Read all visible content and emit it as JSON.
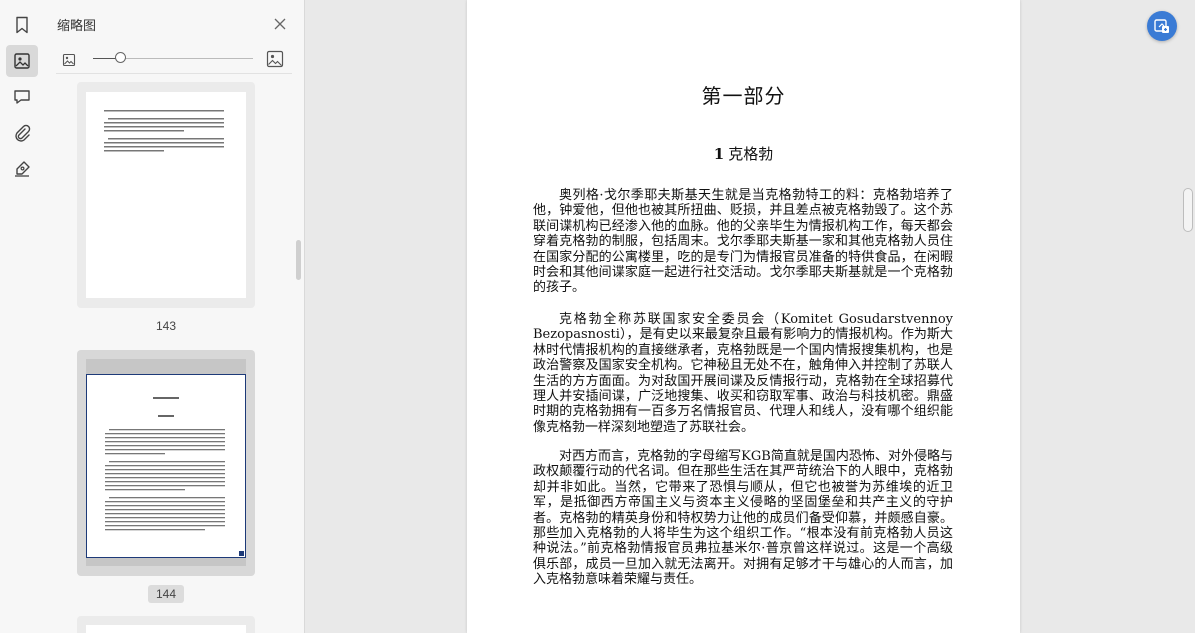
{
  "sidebar": {
    "icons": [
      {
        "name": "bookmark-icon",
        "active": false
      },
      {
        "name": "thumbnail-icon",
        "active": true
      },
      {
        "name": "comment-icon",
        "active": false
      },
      {
        "name": "attachment-icon",
        "active": false
      },
      {
        "name": "signature-icon",
        "active": false
      }
    ]
  },
  "thumbnail_panel": {
    "title": "缩略图",
    "zoom_level": 0.17,
    "thumbnails": [
      {
        "page_label": "143",
        "selected": false
      },
      {
        "page_label": "144",
        "selected": true
      }
    ]
  },
  "document": {
    "part_title": "第一部分",
    "chapter_number": "1",
    "chapter_title": "克格勃",
    "paragraphs": [
      "奥列格·戈尔季耶夫斯基天生就是当克格勃特工的料：克格勃培养了他，钟爱他，但他也被其所扭曲、贬损，并且差点被克格勃毁了。这个苏联间谍机构已经渗入他的血脉。他的父亲毕生为情报机构工作，每天都会穿着克格勃的制服，包括周末。戈尔季耶夫斯基一家和其他克格勃人员住在国家分配的公寓楼里，吃的是专门为情报官员准备的特供食品，在闲暇时会和其他间谍家庭一起进行社交活动。戈尔季耶夫斯基就是一个克格勃的孩子。",
      "克格勃全称苏联国家安全委员会（Komitet Gosudarstvennoy Bezopasnosti），是有史以来最复杂且最有影响力的情报机构。作为斯大林时代情报机构的直接继承者，克格勃既是一个国内情报搜集机构，也是政治警察及国家安全机构。它神秘且无处不在，触角伸入并控制了苏联人生活的方方面面。为对敌国开展间谍及反情报行动，克格勃在全球招募代理人并安插间谍，广泛地搜集、收买和窃取军事、政治与科技机密。鼎盛时期的克格勃拥有一百多万名情报官员、代理人和线人，没有哪个组织能像克格勃一样深刻地塑造了苏联社会。",
      "对西方而言，克格勃的字母缩写KGB简直就是国内恐怖、对外侵略与政权颠覆行动的代名词。但在那些生活在其严苛统治下的人眼中，克格勃却并非如此。当然，它带来了恐惧与顺从，但它也被誉为苏维埃的近卫军，是抵御西方帝国主义与资本主义侵略的坚固堡垒和共产主义的守护者。克格勃的精英身份和特权势力让他的成员们备受仰慕，并颇感自豪。那些加入克格勃的人将毕生为这个组织工作。“根本没有前克格勃人员这种说法。”前克格勃情报官员弗拉基米尔·普京曾这样说过。这是一个高级俱乐部，成员一旦加入就无法离开。对拥有足够才干与雄心的人而言，加入克格勃意味着荣耀与责任。"
    ]
  },
  "colors": {
    "accent": "#3a7bd5",
    "selected_thumb_border": "#1d3a78"
  }
}
